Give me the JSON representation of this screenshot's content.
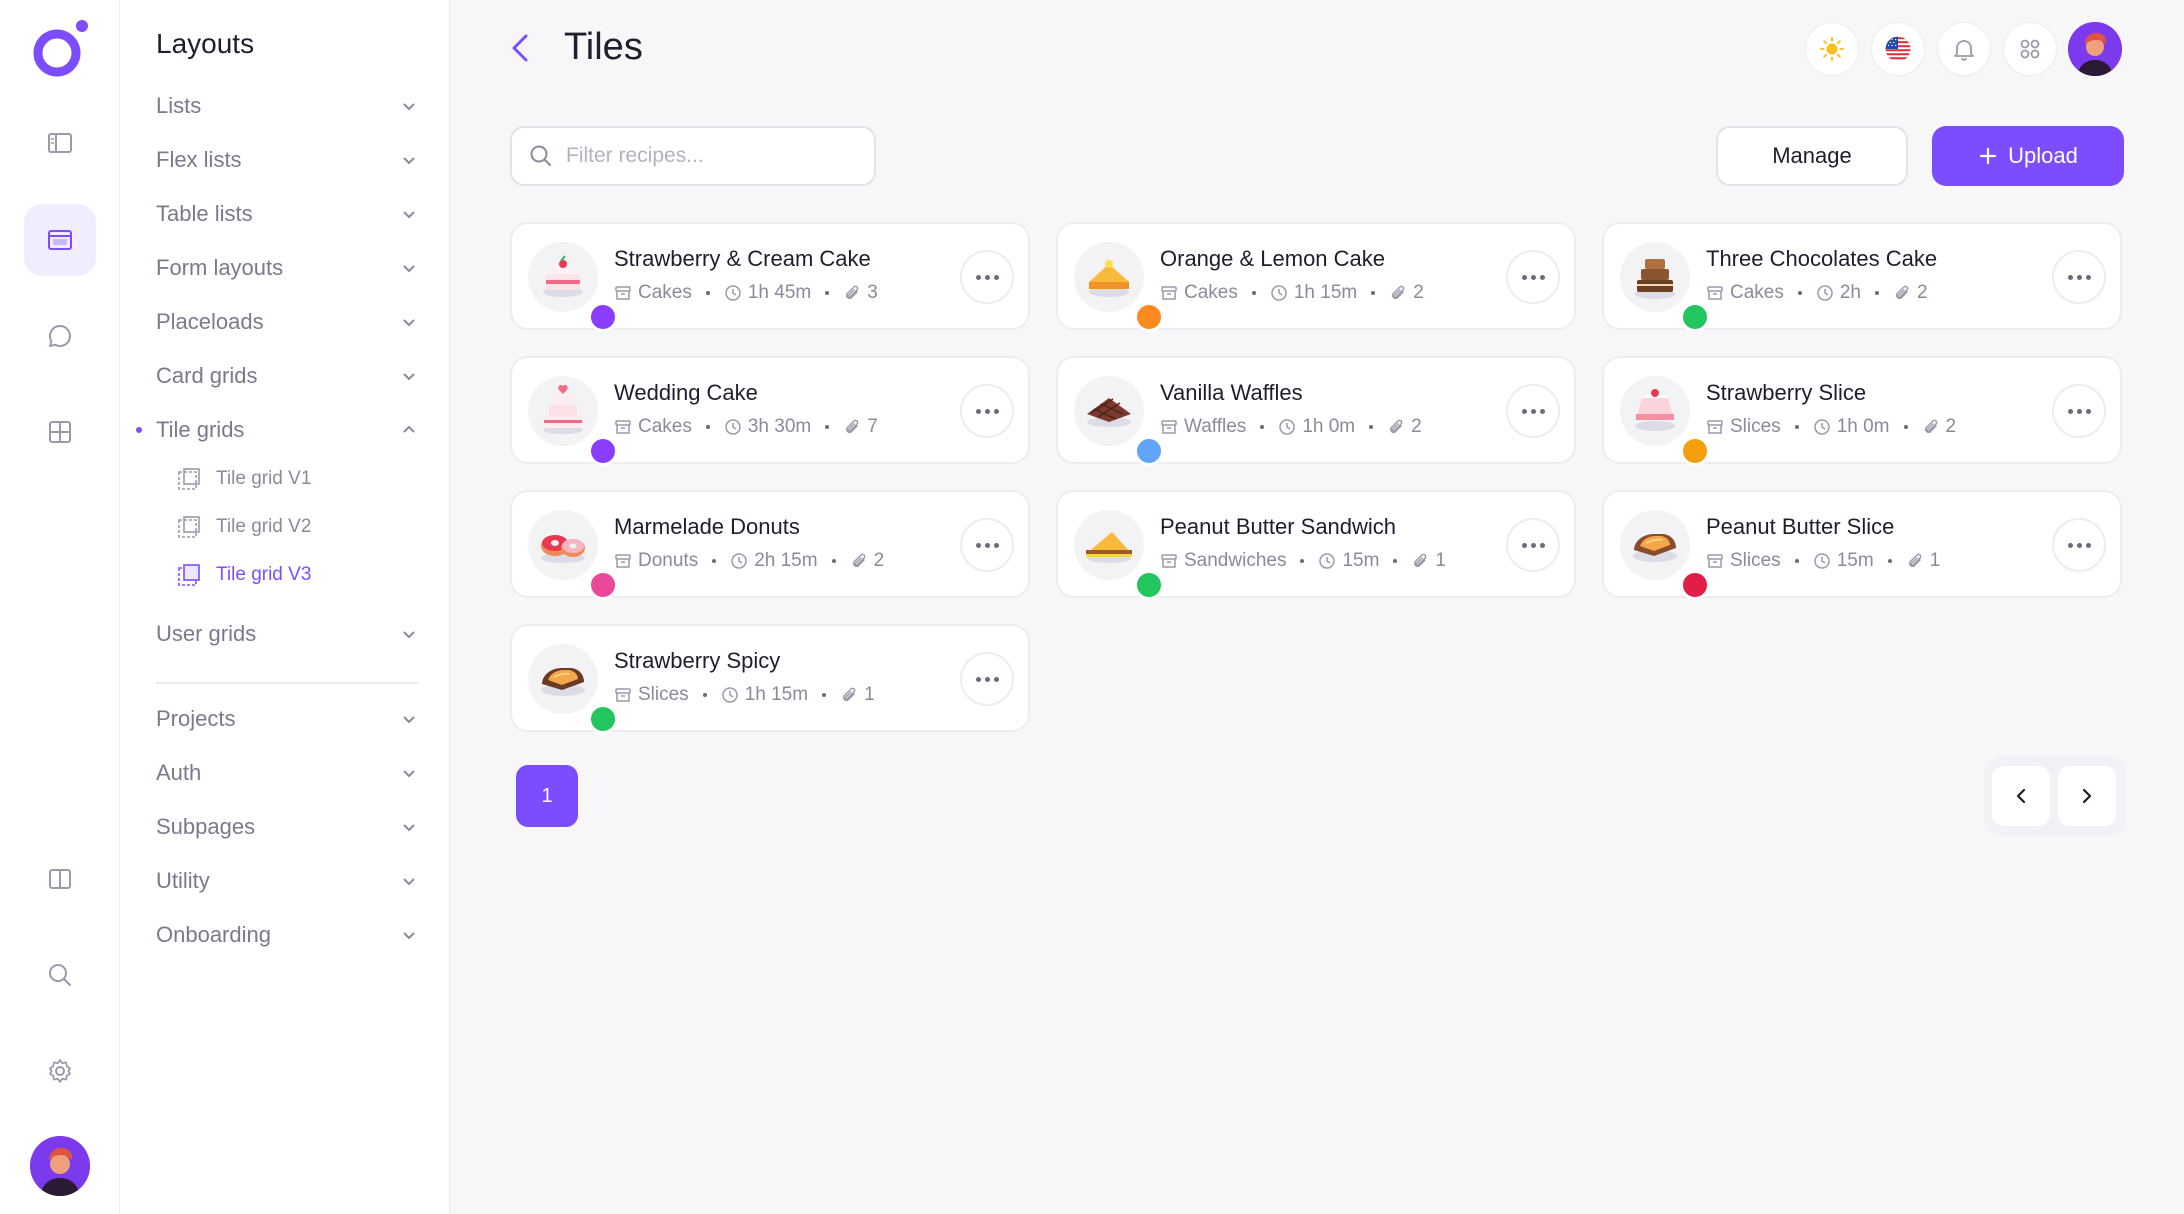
{
  "menu": {
    "title": "Layouts",
    "items": [
      {
        "label": "Lists"
      },
      {
        "label": "Flex lists"
      },
      {
        "label": "Table lists"
      },
      {
        "label": "Form layouts"
      },
      {
        "label": "Placeloads"
      },
      {
        "label": "Card grids"
      },
      {
        "label": "Tile grids"
      },
      {
        "label": "User grids"
      },
      {
        "label": "Projects"
      },
      {
        "label": "Auth"
      },
      {
        "label": "Subpages"
      },
      {
        "label": "Utility"
      },
      {
        "label": "Onboarding"
      }
    ],
    "sub_items": [
      {
        "label": "Tile grid V1"
      },
      {
        "label": "Tile grid V2"
      },
      {
        "label": "Tile grid V3"
      }
    ],
    "active_sub_item": "Tile grid V3"
  },
  "header": {
    "title": "Tiles"
  },
  "toolbar": {
    "search_placeholder": "Filter recipes...",
    "manage_label": "Manage",
    "upload_label": "Upload"
  },
  "tiles": [
    {
      "name": "Strawberry & Cream Cake",
      "category": "Cakes",
      "time": "1h 45m",
      "attachments": "3",
      "food": "strawberry-cream-cake",
      "avatar_color": "#8b3dff"
    },
    {
      "name": "Orange & Lemon Cake",
      "category": "Cakes",
      "time": "1h 15m",
      "attachments": "2",
      "food": "orange-lemon-cake",
      "avatar_color": "#ff8a1f"
    },
    {
      "name": "Three Chocolates Cake",
      "category": "Cakes",
      "time": "2h",
      "attachments": "2",
      "food": "three-chocolates-cake",
      "avatar_color": "#22c55e"
    },
    {
      "name": "Wedding Cake",
      "category": "Cakes",
      "time": "3h 30m",
      "attachments": "7",
      "food": "wedding-cake",
      "avatar_color": "#8b3dff"
    },
    {
      "name": "Vanilla Waffles",
      "category": "Waffles",
      "time": "1h 0m",
      "attachments": "2",
      "food": "vanilla-waffles",
      "avatar_color": "#60a5fa"
    },
    {
      "name": "Strawberry Slice",
      "category": "Slices",
      "time": "1h 0m",
      "attachments": "2",
      "food": "strawberry-slice",
      "avatar_color": "#f59e0b"
    },
    {
      "name": "Marmelade Donuts",
      "category": "Donuts",
      "time": "2h 15m",
      "attachments": "2",
      "food": "marmelade-donuts",
      "avatar_color": "#ec4899"
    },
    {
      "name": "Peanut Butter Sandwich",
      "category": "Sandwiches",
      "time": "15m",
      "attachments": "1",
      "food": "peanut-butter-sandwich",
      "avatar_color": "#22c55e"
    },
    {
      "name": "Peanut Butter Slice",
      "category": "Slices",
      "time": "15m",
      "attachments": "1",
      "food": "peanut-butter-slice",
      "avatar_color": "#e11d48"
    },
    {
      "name": "Strawberry Spicy",
      "category": "Slices",
      "time": "1h 15m",
      "attachments": "1",
      "food": "strawberry-spicy",
      "avatar_color": "#22c55e"
    }
  ],
  "pagination": {
    "current_page": "1"
  },
  "colors": {
    "accent": "#7c4dff",
    "accent_soft": "#f1edff",
    "background": "#f7f7f9"
  },
  "icons": {
    "rail": [
      "sidebar-icon",
      "layout-icon",
      "chat-icon",
      "grid-icon",
      "columns-icon",
      "search-icon",
      "settings-icon"
    ],
    "header": [
      "sun-icon",
      "us-flag-icon",
      "bell-icon",
      "apps-icon"
    ],
    "meta": [
      "archive-icon",
      "clock-icon",
      "paperclip-icon"
    ]
  }
}
